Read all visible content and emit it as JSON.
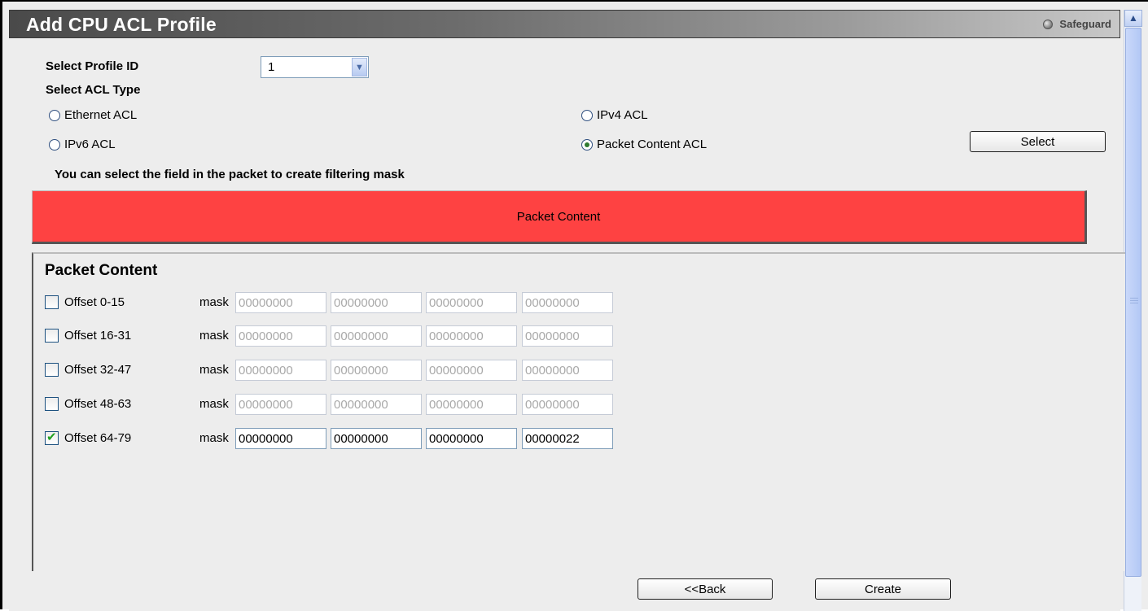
{
  "header": {
    "title": "Add CPU ACL Profile",
    "safeguard": "Safeguard"
  },
  "form": {
    "profile_id_label": "Select Profile ID",
    "profile_id_value": "1",
    "acl_type_label": "Select ACL Type",
    "acl_types": [
      {
        "label": "Ethernet ACL",
        "selected": false
      },
      {
        "label": "IPv4 ACL",
        "selected": false
      },
      {
        "label": "IPv6 ACL",
        "selected": false
      },
      {
        "label": "Packet Content ACL",
        "selected": true
      }
    ],
    "select_button": "Select",
    "hint": "You can select the field in the packet to create filtering mask"
  },
  "packet_content_bar": "Packet Content",
  "panel": {
    "title": "Packet Content",
    "mask_label": "mask",
    "rows": [
      {
        "label": "Offset 0-15",
        "checked": false,
        "masks": [
          "00000000",
          "00000000",
          "00000000",
          "00000000"
        ]
      },
      {
        "label": "Offset 16-31",
        "checked": false,
        "masks": [
          "00000000",
          "00000000",
          "00000000",
          "00000000"
        ]
      },
      {
        "label": "Offset 32-47",
        "checked": false,
        "masks": [
          "00000000",
          "00000000",
          "00000000",
          "00000000"
        ]
      },
      {
        "label": "Offset 48-63",
        "checked": false,
        "masks": [
          "00000000",
          "00000000",
          "00000000",
          "00000000"
        ]
      },
      {
        "label": "Offset 64-79",
        "checked": true,
        "masks": [
          "00000000",
          "00000000",
          "00000000",
          "00000022"
        ]
      }
    ]
  },
  "footer": {
    "back_button": "<<Back",
    "create_button": "Create"
  },
  "colors": {
    "red_bar": "#fe4242",
    "title_bar_start": "#4a4a4a",
    "title_bar_end": "#c8c8c8"
  },
  "icons": {
    "dropdown": "chevron-down-icon",
    "safeguard": "status-dot-icon",
    "scroll_up": "scroll-up-icon"
  }
}
